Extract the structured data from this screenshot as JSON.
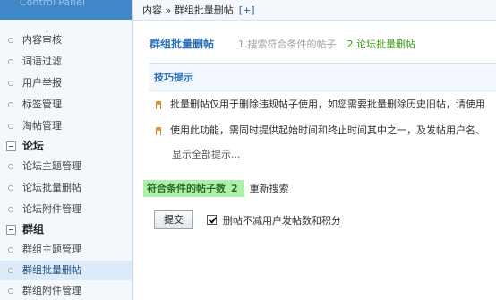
{
  "sidebar": {
    "brand": "Control Panel",
    "items": [
      {
        "label": "内容审核"
      },
      {
        "label": "词语过滤"
      },
      {
        "label": "用户举报"
      },
      {
        "label": "标签管理"
      },
      {
        "label": "淘帖管理"
      }
    ],
    "groups": [
      {
        "title": "论坛",
        "items": [
          "论坛主题管理",
          "论坛批量删帖",
          "论坛附件管理"
        ]
      },
      {
        "title": "群组",
        "items": [
          "群组主题管理",
          "群组批量删帖",
          "群组附件管理"
        ]
      }
    ],
    "active_item": "群组批量删帖"
  },
  "breadcrumb": {
    "path": "内容 » 群组批量删帖",
    "add": "[+]"
  },
  "title": {
    "heading": "群组批量删帖",
    "step1": "1.搜索符合条件的帖子",
    "step2": "2.论坛批量删帖"
  },
  "tips": {
    "heading": "技巧提示",
    "lines": [
      "批量删帖仅用于删除违规帖子使用，如您需要批量删除历史旧帖，请使用",
      "使用此功能，需同时提供起始时间和终止时间其中之一，及发帖用户名、"
    ],
    "show_all": "显示全部提示..."
  },
  "result": {
    "label": "符合条件的帖子数",
    "count": "2",
    "research": "重新搜索"
  },
  "form": {
    "submit": "提交",
    "checkbox_label": "删帖不减用户发帖数和积分",
    "checkbox_checked": true
  }
}
